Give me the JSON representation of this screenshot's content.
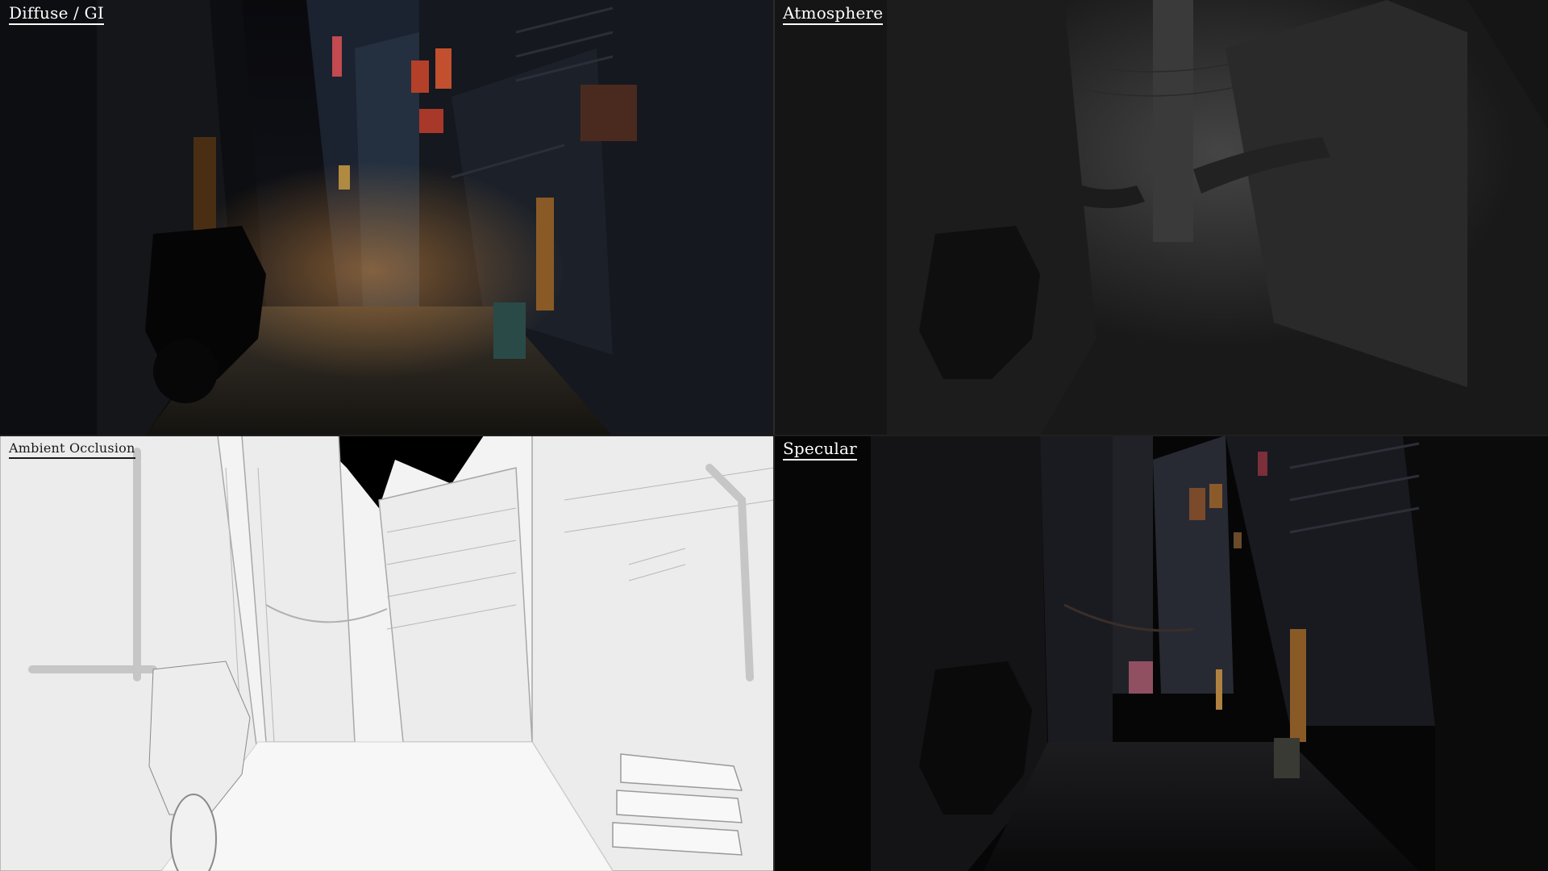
{
  "panels": [
    {
      "id": "diffuse",
      "label": "Diffuse / GI"
    },
    {
      "id": "atmosphere",
      "label": "Atmosphere"
    },
    {
      "id": "ao",
      "label": "Ambient Occlusion"
    },
    {
      "id": "specular",
      "label": "Specular"
    }
  ],
  "colors": {
    "diffuse_bg": "#0c0d10",
    "atmosphere_bg": "#141414",
    "ao_bg": "#f4f4f4",
    "specular_bg": "#050505",
    "label_light": "#ffffff",
    "label_dark": "#1a1a1a",
    "warm_light": "#d97a32",
    "neon_red": "#c23a2a",
    "neon_pink": "#c0647a"
  }
}
